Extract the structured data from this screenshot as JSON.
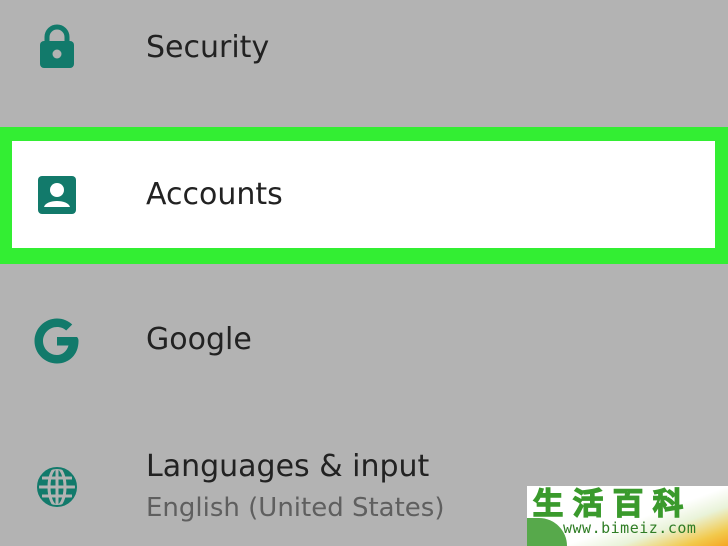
{
  "theme": {
    "background": "#b3b3b3",
    "icon_color": "#127a6b",
    "highlight_border": "#33ee33",
    "highlight_fill": "#ffffff"
  },
  "settings": {
    "items": [
      {
        "label": "Security",
        "icon": "lock-icon"
      },
      {
        "label": "Accounts",
        "icon": "account-box-icon",
        "highlighted": true
      },
      {
        "label": "Google",
        "icon": "google-g-icon"
      },
      {
        "label": "Languages & input",
        "sublabel": "English (United States)",
        "icon": "globe-icon"
      }
    ]
  },
  "watermark": {
    "title": "生活百科",
    "url": "www.bimeiz.com"
  }
}
